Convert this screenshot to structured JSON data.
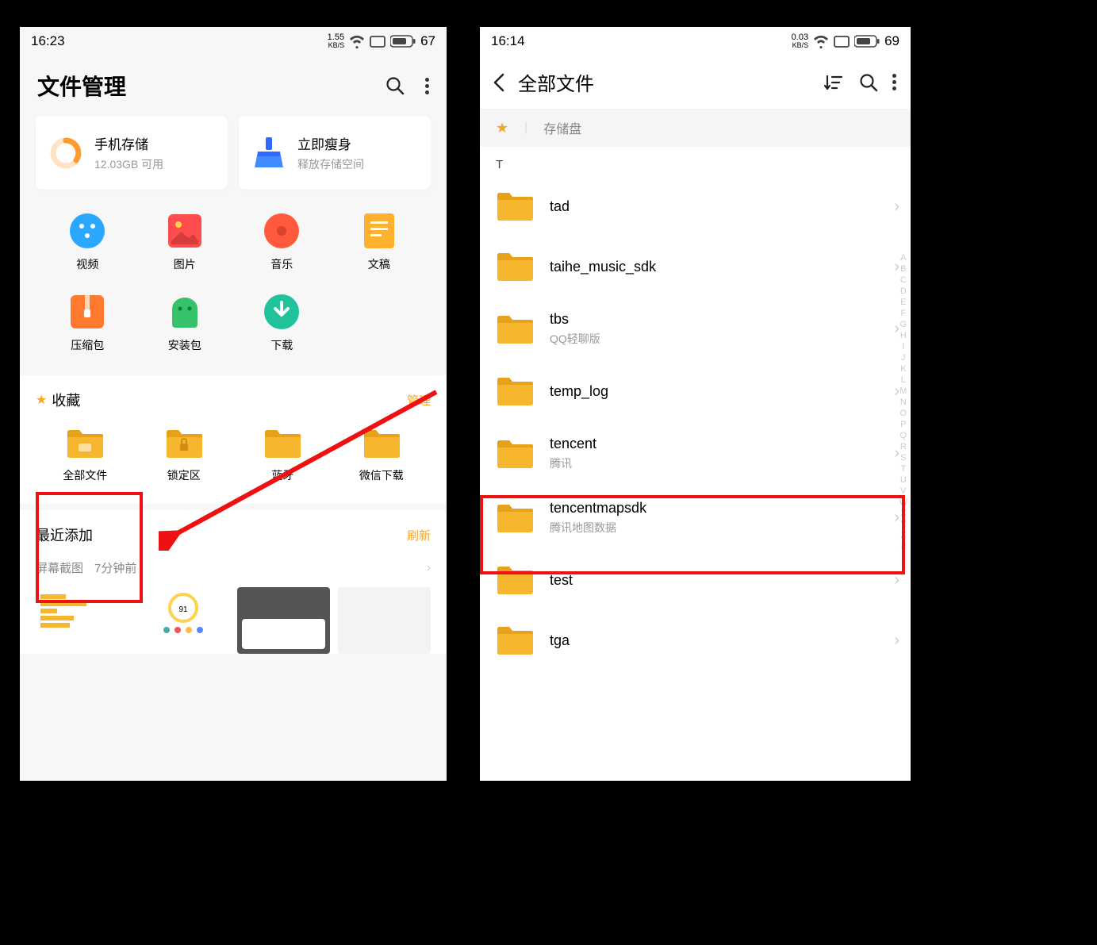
{
  "left": {
    "status": {
      "time": "16:23",
      "net_speed": "1.55",
      "net_unit": "KB/S",
      "battery": "67"
    },
    "title": "文件管理",
    "card_storage": {
      "title": "手机存储",
      "subtitle": "12.03GB 可用"
    },
    "card_clean": {
      "title": "立即瘦身",
      "subtitle": "释放存储空间"
    },
    "cats": {
      "video": "视频",
      "image": "图片",
      "music": "音乐",
      "doc": "文稿",
      "zip": "压缩包",
      "apk": "安装包",
      "download": "下载"
    },
    "fav_title": "收藏",
    "fav_manage": "管理",
    "favs": {
      "all": "全部文件",
      "lock": "锁定区",
      "bt": "蓝牙",
      "wx": "微信下载"
    },
    "recent_title": "最近添加",
    "recent_refresh": "刷新",
    "recent_src": "屏幕截图",
    "recent_time": "7分钟前"
  },
  "right": {
    "status": {
      "time": "16:14",
      "net_speed": "0.03",
      "net_unit": "KB/S",
      "battery": "69"
    },
    "title": "全部文件",
    "crumb": "存储盘",
    "section_letter": "T",
    "az": [
      "A",
      "B",
      "C",
      "D",
      "E",
      "F",
      "G",
      "H",
      "I",
      "J",
      "K",
      "L",
      "M",
      "N",
      "O",
      "P",
      "Q",
      "R",
      "S",
      "T",
      "U",
      "V",
      "W",
      "X",
      "Y",
      "Z",
      "#"
    ],
    "folders": [
      {
        "name": "tad",
        "sub": ""
      },
      {
        "name": "taihe_music_sdk",
        "sub": ""
      },
      {
        "name": "tbs",
        "sub": "QQ轻聊版"
      },
      {
        "name": "temp_log",
        "sub": ""
      },
      {
        "name": "tencent",
        "sub": "腾讯"
      },
      {
        "name": "tencentmapsdk",
        "sub": "腾讯地图数据"
      },
      {
        "name": "test",
        "sub": ""
      },
      {
        "name": "tga",
        "sub": ""
      }
    ]
  }
}
